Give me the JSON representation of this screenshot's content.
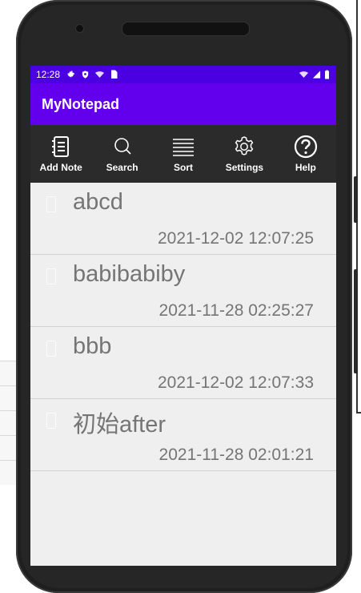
{
  "status_bar": {
    "time": "12:28"
  },
  "app": {
    "title": "MyNotepad"
  },
  "toolbar": {
    "add_note": "Add Note",
    "search": "Search",
    "sort": "Sort",
    "settings": "Settings",
    "help": "Help"
  },
  "notes": [
    {
      "title": "abcd",
      "time": "2021-12-02 12:07:25"
    },
    {
      "title": "babibabiby",
      "time": "2021-11-28 02:25:27"
    },
    {
      "title": "bbb",
      "time": "2021-12-02 12:07:33"
    },
    {
      "title": "初始after",
      "time": "2021-11-28 02:01:21"
    }
  ],
  "colors": {
    "status_bar": "#4a00e0",
    "app_bar": "#6200ee",
    "toolbar": "#2b2b2b",
    "list_bg": "#efefef",
    "text_gray": "#757575"
  }
}
